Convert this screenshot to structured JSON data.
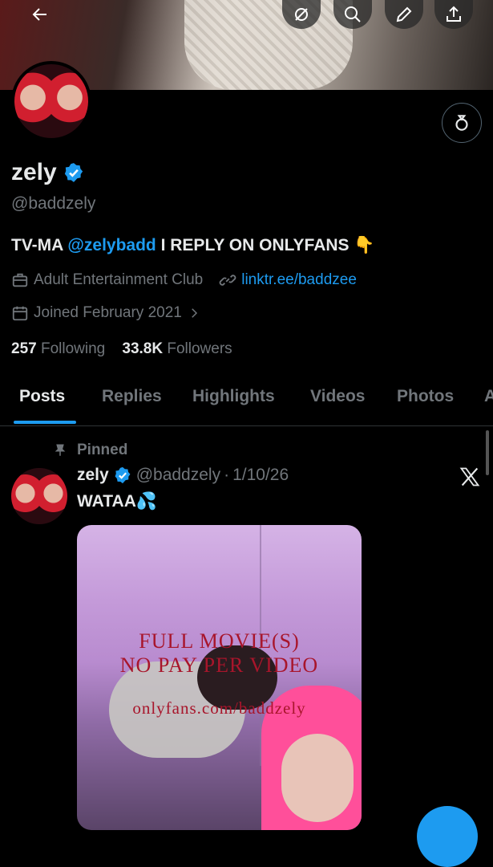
{
  "colors": {
    "accent": "#1d9bf0",
    "text": "#e7e9ea",
    "muted": "#71767b",
    "background": "#000000"
  },
  "header_icons": [
    "back-arrow-icon",
    "no-notifications-icon",
    "search-icon",
    "edit-icon",
    "share-icon"
  ],
  "profile": {
    "name": "zely",
    "handle": "@baddzely",
    "bio_prefix": "TV-MA",
    "bio_mention": "@zelybadd",
    "bio_suffix": "I REPLY ON ONLYFANS 👇",
    "category": "Adult Entertainment Club",
    "link": "linktr.ee/baddzee",
    "joined": "Joined February 2021",
    "following_count": "257",
    "following_label": "Following",
    "followers_count": "33.8K",
    "followers_label": "Followers"
  },
  "tabs": [
    {
      "label": "Posts",
      "active": true
    },
    {
      "label": "Replies"
    },
    {
      "label": "Highlights"
    },
    {
      "label": "Videos"
    },
    {
      "label": "Photos"
    },
    {
      "label": "A"
    }
  ],
  "post": {
    "pinned_label": "Pinned",
    "name": "zely",
    "handle": "@baddzely",
    "separator": "·",
    "date": "1/10/26",
    "text": "WATAA💦",
    "media_text_line1": "FULL MOVIE(S)",
    "media_text_line2": "NO PAY PER VIDEO",
    "media_text_line3": "onlyfans.com/baddzely"
  }
}
